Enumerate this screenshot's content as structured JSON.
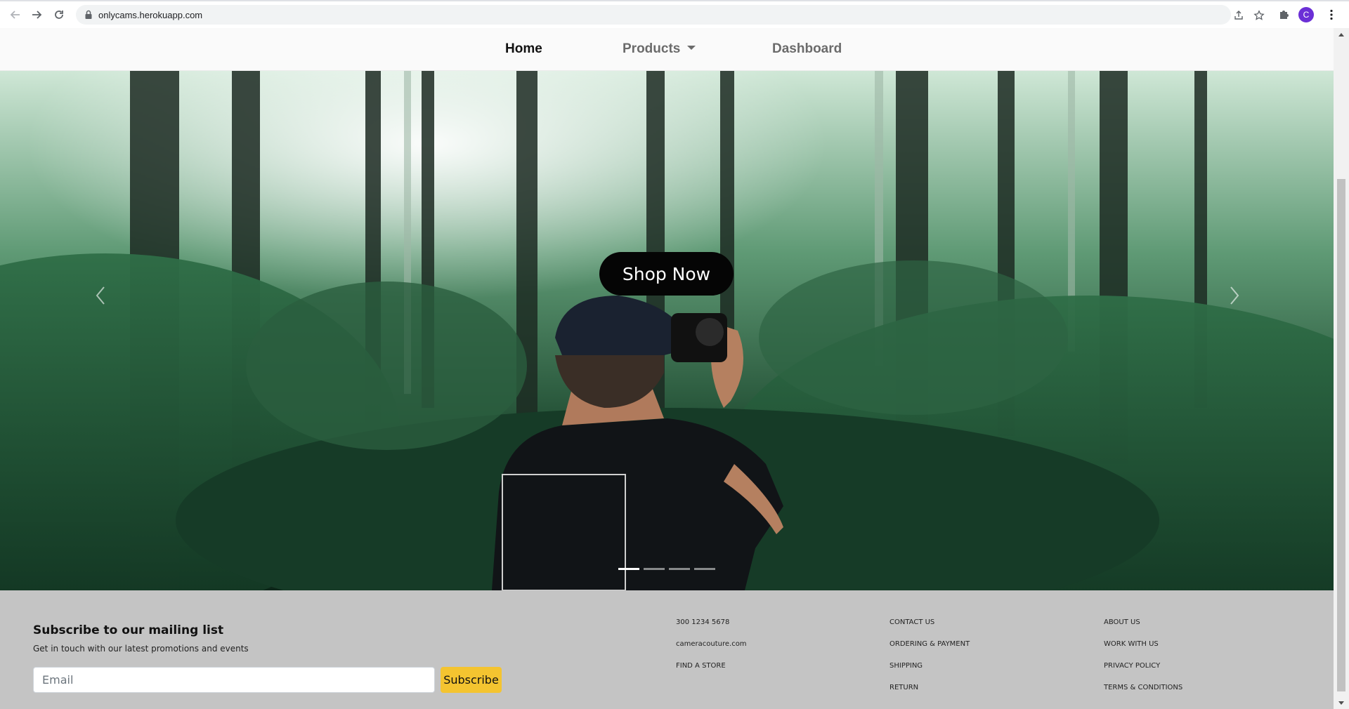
{
  "browser": {
    "url": "onlycams.herokuapp.com",
    "profile_initial": "C",
    "profile_color": "#6b2fd6"
  },
  "navbar": {
    "home": "Home",
    "products": "Products",
    "dashboard": "Dashboard"
  },
  "hero": {
    "cta_label": "Shop Now",
    "slide_count": 4,
    "active_slide": 1
  },
  "footer": {
    "subscribe_title": "Subscribe to our mailing list",
    "subscribe_text": "Get in touch with our latest promotions and events",
    "email_placeholder": "Email",
    "subscribe_button": "Subscribe",
    "subscribe_button_color": "#f4c430",
    "contact": {
      "phone": "300 1234 5678",
      "email": "cameracouture.com",
      "find_store": "FIND A STORE"
    },
    "column_2": [
      "CONTACT US",
      "ORDERING & PAYMENT",
      "SHIPPING",
      "RETURN"
    ],
    "column_3": [
      "ABOUT US",
      "WORK WITH US",
      "PRIVACY POLICY",
      "TERMS & CONDITIONS"
    ]
  }
}
